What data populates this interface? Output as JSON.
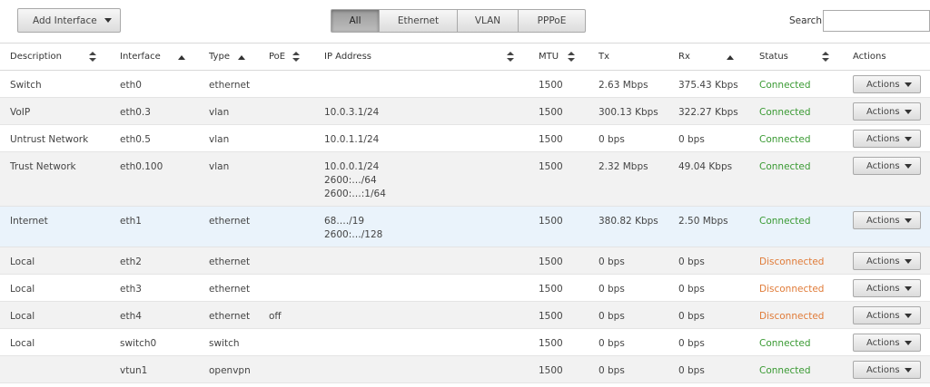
{
  "toolbar": {
    "add_interface_label": "Add Interface",
    "filters": [
      "All",
      "Ethernet",
      "VLAN",
      "PPPoE"
    ],
    "active_filter": "All",
    "search_label": "Search",
    "search_value": ""
  },
  "columns": [
    "Description",
    "Interface",
    "Type",
    "PoE",
    "IP Address",
    "MTU",
    "Tx",
    "Rx",
    "Status",
    "Actions"
  ],
  "rows": [
    {
      "description": "Switch",
      "interface": "eth0",
      "type": "ethernet",
      "poe": "",
      "ip": [],
      "mtu": "1500",
      "tx": "2.63 Mbps",
      "rx": "375.43 Kbps",
      "status": "Connected",
      "action_label": "Actions"
    },
    {
      "description": "VoIP",
      "interface": "eth0.3",
      "type": "vlan",
      "poe": "",
      "ip": [
        "10.0.3.1/24"
      ],
      "mtu": "1500",
      "tx": "300.13 Kbps",
      "rx": "322.27 Kbps",
      "status": "Connected",
      "action_label": "Actions"
    },
    {
      "description": "Untrust Network",
      "interface": "eth0.5",
      "type": "vlan",
      "poe": "",
      "ip": [
        "10.0.1.1/24"
      ],
      "mtu": "1500",
      "tx": "0 bps",
      "rx": "0 bps",
      "status": "Connected",
      "action_label": "Actions"
    },
    {
      "description": "Trust Network",
      "interface": "eth0.100",
      "type": "vlan",
      "poe": "",
      "ip": [
        "10.0.0.1/24",
        "2600:…/64",
        "2600:…:1/64"
      ],
      "mtu": "1500",
      "tx": "2.32 Mbps",
      "rx": "49.04 Kbps",
      "status": "Connected",
      "action_label": "Actions"
    },
    {
      "description": "Internet",
      "interface": "eth1",
      "type": "ethernet",
      "poe": "",
      "ip": [
        "68.…/19",
        "2600:…/128"
      ],
      "mtu": "1500",
      "tx": "380.82 Kbps",
      "rx": "2.50 Mbps",
      "status": "Connected",
      "action_label": "Actions"
    },
    {
      "description": "Local",
      "interface": "eth2",
      "type": "ethernet",
      "poe": "",
      "ip": [],
      "mtu": "1500",
      "tx": "0 bps",
      "rx": "0 bps",
      "status": "Disconnected",
      "action_label": "Actions"
    },
    {
      "description": "Local",
      "interface": "eth3",
      "type": "ethernet",
      "poe": "",
      "ip": [],
      "mtu": "1500",
      "tx": "0 bps",
      "rx": "0 bps",
      "status": "Disconnected",
      "action_label": "Actions"
    },
    {
      "description": "Local",
      "interface": "eth4",
      "type": "ethernet",
      "poe": "off",
      "ip": [],
      "mtu": "1500",
      "tx": "0 bps",
      "rx": "0 bps",
      "status": "Disconnected",
      "action_label": "Actions"
    },
    {
      "description": "Local",
      "interface": "switch0",
      "type": "switch",
      "poe": "",
      "ip": [],
      "mtu": "1500",
      "tx": "0 bps",
      "rx": "0 bps",
      "status": "Connected",
      "action_label": "Actions"
    },
    {
      "description": "",
      "interface": "vtun1",
      "type": "openvpn",
      "poe": "",
      "ip": [],
      "mtu": "1500",
      "tx": "0 bps",
      "rx": "0 bps",
      "status": "Connected",
      "action_label": "Actions"
    }
  ],
  "colors": {
    "connected": "#3a9a33",
    "disconnected": "#e07b38",
    "highlight_row": "#eaf3fb"
  }
}
